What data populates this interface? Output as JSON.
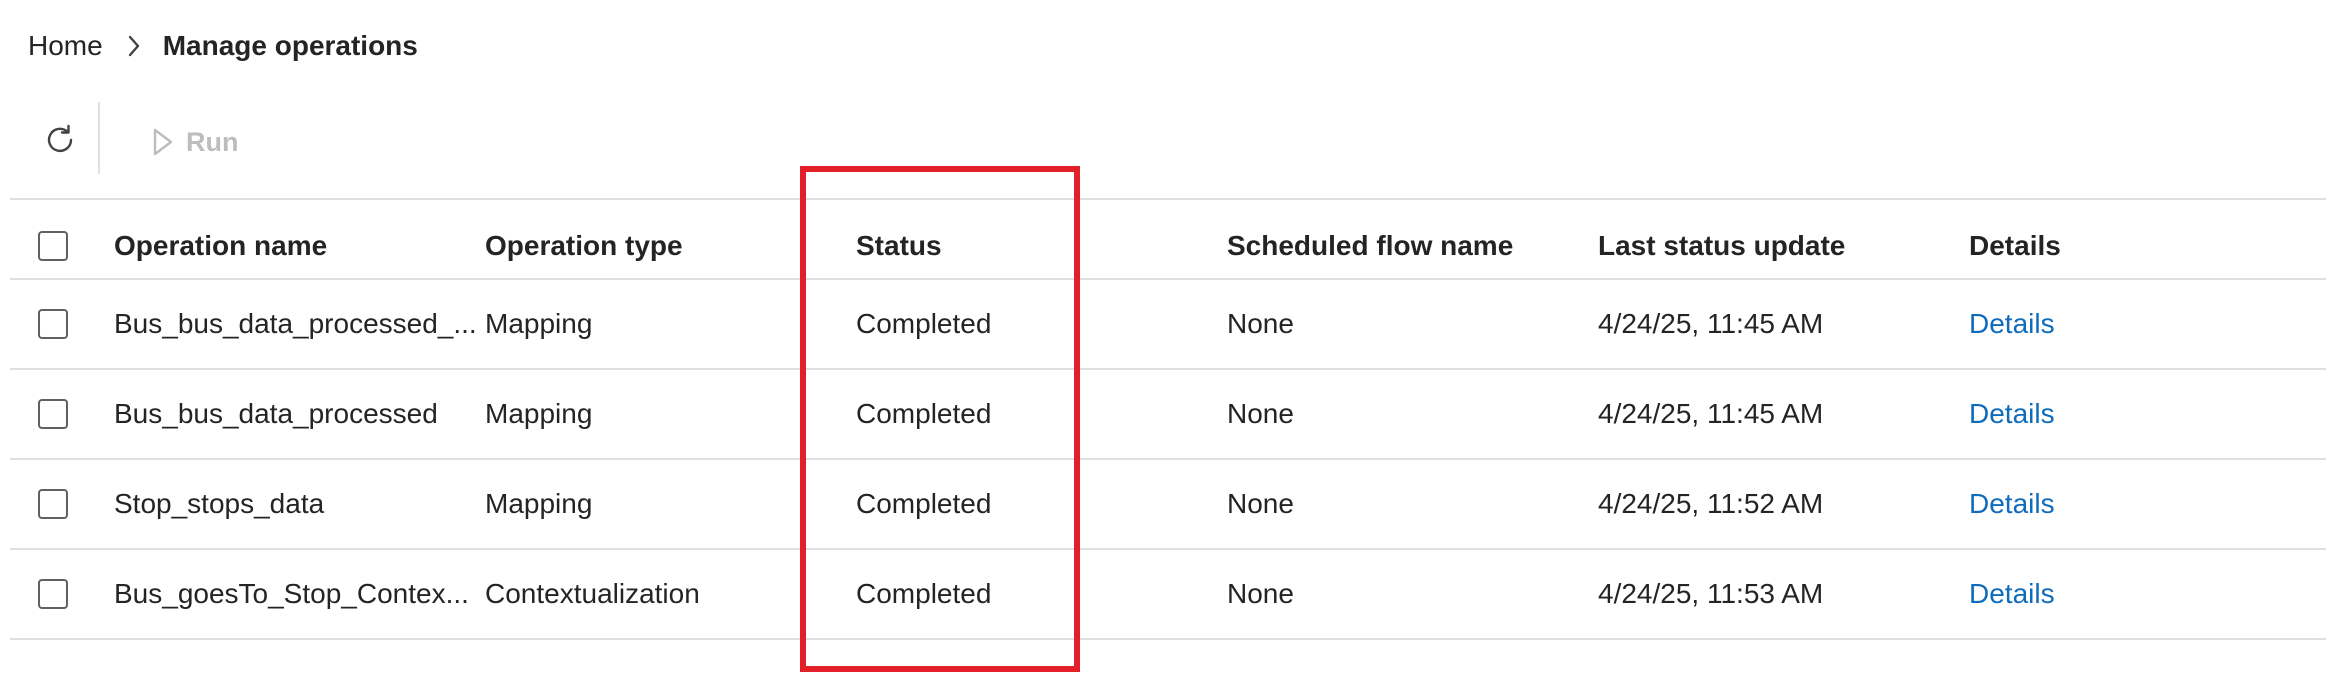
{
  "breadcrumb": {
    "home": "Home",
    "current": "Manage operations"
  },
  "toolbar": {
    "refresh_icon": "refresh-icon",
    "run_label": "Run",
    "run_icon": "play-icon"
  },
  "table": {
    "headers": {
      "name": "Operation name",
      "type": "Operation type",
      "status": "Status",
      "flow": "Scheduled flow name",
      "update": "Last status update",
      "details": "Details"
    },
    "rows": [
      {
        "name": "Bus_bus_data_processed_...",
        "type": "Mapping",
        "status": "Completed",
        "flow": "None",
        "update": "4/24/25, 11:45 AM",
        "details": "Details"
      },
      {
        "name": "Bus_bus_data_processed",
        "type": "Mapping",
        "status": "Completed",
        "flow": "None",
        "update": "4/24/25, 11:45 AM",
        "details": "Details"
      },
      {
        "name": "Stop_stops_data",
        "type": "Mapping",
        "status": "Completed",
        "flow": "None",
        "update": "4/24/25, 11:52 AM",
        "details": "Details"
      },
      {
        "name": "Bus_goesTo_Stop_Contex...",
        "type": "Contextualization",
        "status": "Completed",
        "flow": "None",
        "update": "4/24/25, 11:53 AM",
        "details": "Details"
      }
    ]
  },
  "colors": {
    "link": "#0f6cbd",
    "highlight": "#e3202a",
    "disabled": "#bdbdbd"
  }
}
